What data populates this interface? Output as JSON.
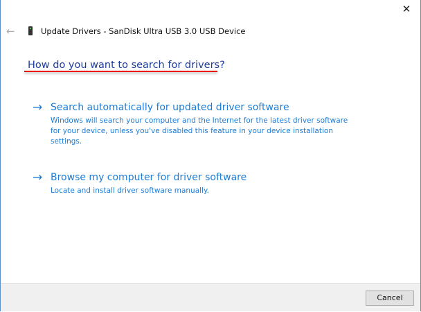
{
  "window": {
    "close_glyph": "✕",
    "back_glyph": "←",
    "title": "Update Drivers - SanDisk Ultra USB 3.0 USB Device"
  },
  "heading": "How do you want to search for drivers?",
  "options": [
    {
      "arrow": "→",
      "label": "Search automatically for updated driver software",
      "description": "Windows will search your computer and the Internet for the latest driver software for your device, unless you've disabled this feature in your device installation settings."
    },
    {
      "arrow": "→",
      "label": "Browse my computer for driver software",
      "description": "Locate and install driver software manually."
    }
  ],
  "footer": {
    "cancel_label": "Cancel"
  },
  "colors": {
    "link": "#1c7cd6",
    "heading": "#1e3c9a",
    "annotation": "#e00000"
  }
}
